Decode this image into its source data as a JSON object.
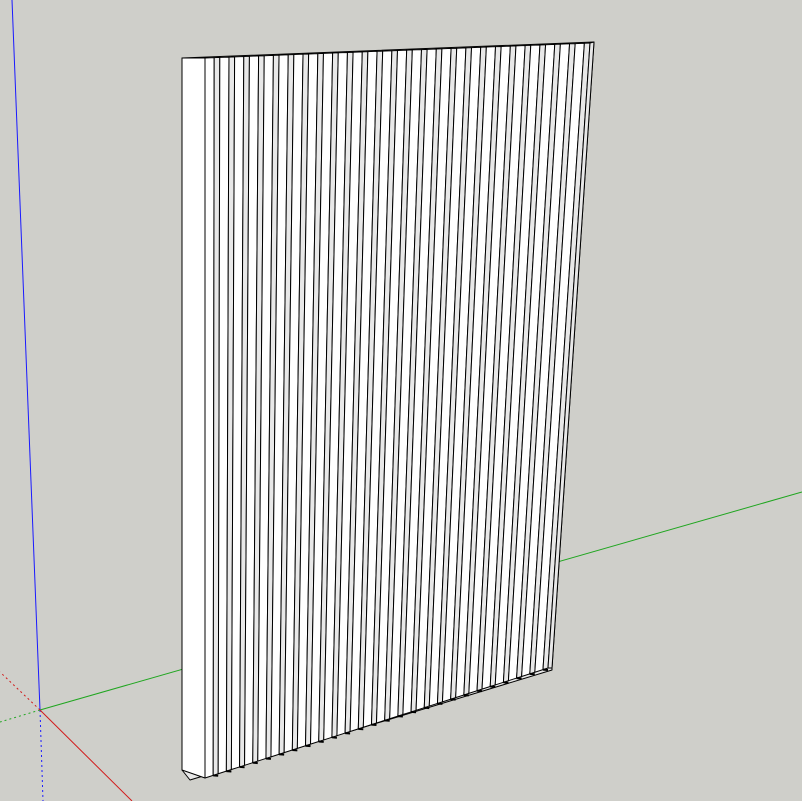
{
  "viewport": {
    "background_color": "#cfcfca"
  },
  "axes": {
    "blue_axis_color": "#1a1aff",
    "green_axis_color": "#1fa61f",
    "red_axis_color": "#d21a1a"
  },
  "model": {
    "face_color": "#ffffff",
    "shadow_face_color": "#e8e8e8",
    "edge_color": "#000000",
    "slat_count": 26
  }
}
